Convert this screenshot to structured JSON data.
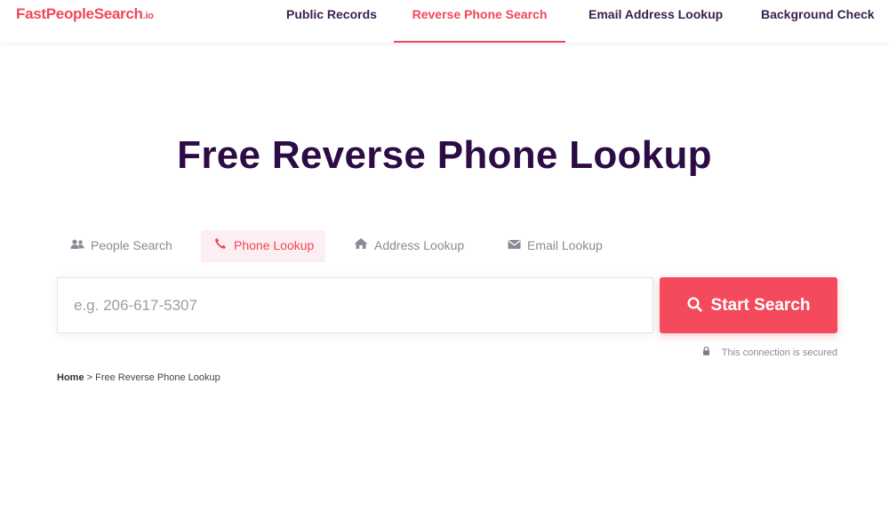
{
  "header": {
    "logo": "FastPeopleSearch",
    "logo_tld": ".io",
    "nav": [
      {
        "label": "Public Records"
      },
      {
        "label": "Reverse Phone Search"
      },
      {
        "label": "Email Address Lookup"
      },
      {
        "label": "Background Check"
      }
    ],
    "active_nav": "Reverse Phone Search"
  },
  "main": {
    "title": "Free Reverse Phone Lookup",
    "tabs": [
      {
        "label": "People Search",
        "icon": "people-icon"
      },
      {
        "label": "Phone Lookup",
        "icon": "phone-icon"
      },
      {
        "label": "Address Lookup",
        "icon": "home-icon"
      },
      {
        "label": "Email Lookup",
        "icon": "envelope-icon"
      }
    ],
    "active_tab": "Phone Lookup",
    "search": {
      "placeholder": "e.g. 206-617-5307",
      "button_label": "Start Search"
    },
    "secure_note": "This connection is secured"
  },
  "breadcrumb": {
    "home": "Home",
    "separator": ">",
    "current": "Free Reverse Phone Lookup"
  },
  "colors": {
    "accent": "#f34b5b",
    "heading": "#2c0c45",
    "nav_text": "#3a1f4f"
  }
}
